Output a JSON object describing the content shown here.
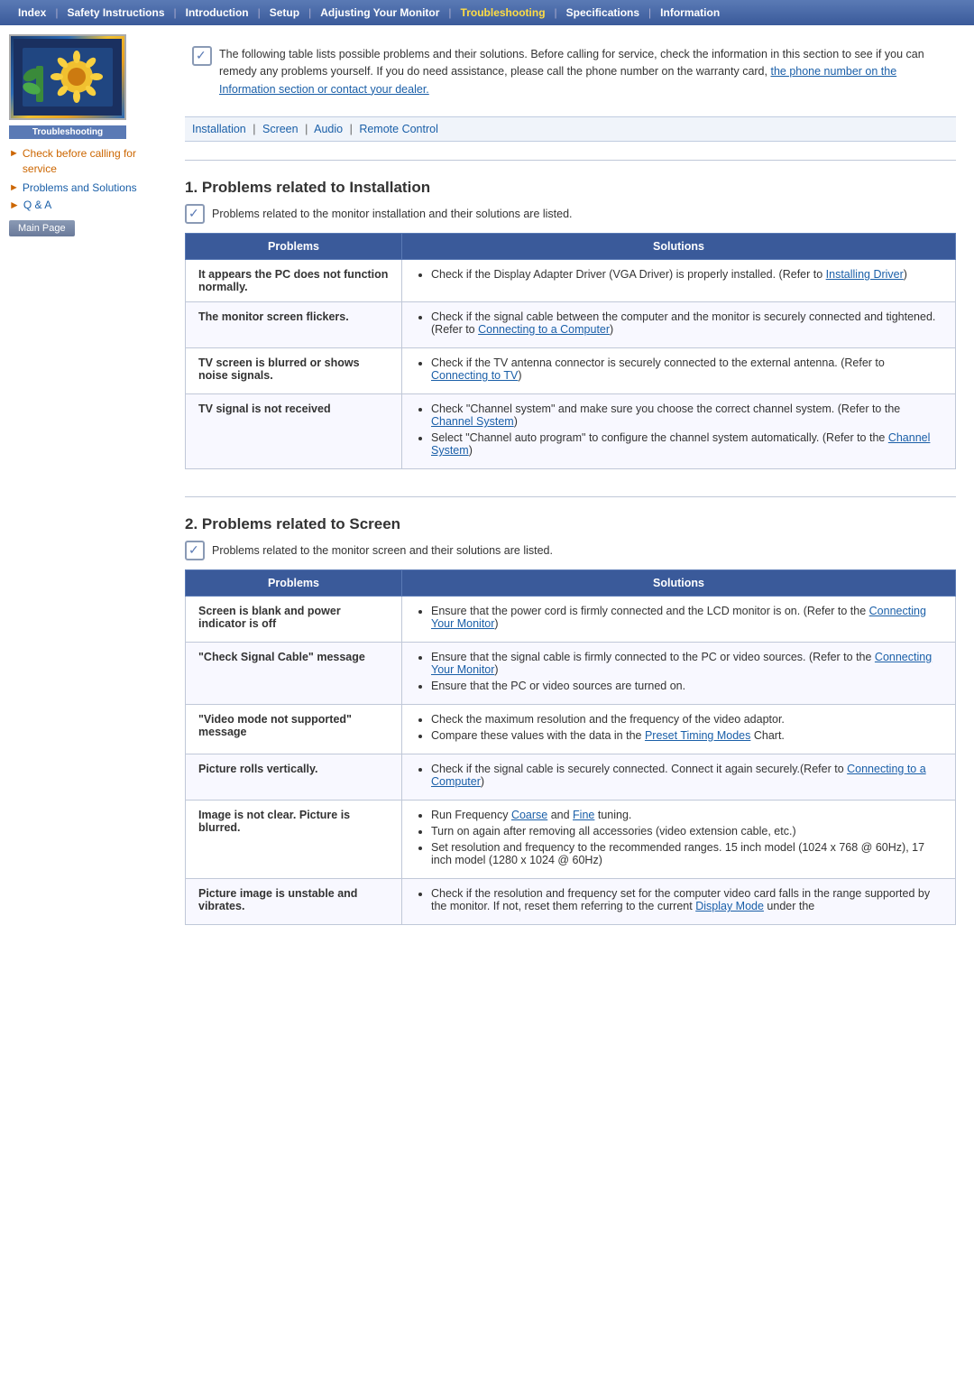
{
  "nav": {
    "items": [
      {
        "label": "Index",
        "active": false
      },
      {
        "label": "Safety Instructions",
        "active": false
      },
      {
        "label": "Introduction",
        "active": false
      },
      {
        "label": "Setup",
        "active": false
      },
      {
        "label": "Adjusting Your Monitor",
        "active": false
      },
      {
        "label": "Troubleshooting",
        "active": true
      },
      {
        "label": "Specifications",
        "active": false
      },
      {
        "label": "Information",
        "active": false
      }
    ]
  },
  "sidebar": {
    "image_label": "Troubleshooting",
    "links": [
      {
        "label": "Check before calling for service",
        "active": true
      },
      {
        "label": "Problems and Solutions",
        "active": false
      }
    ],
    "qa_label": "Q & A",
    "main_page_label": "Main Page"
  },
  "intro": {
    "text": "The following table lists possible problems and their solutions. Before calling for service, check the information in this section to see if you can remedy any problems yourself. If you do need assistance, please call the phone number on the warranty card,",
    "link_text": "the phone number on the Information section or contact your dealer.",
    "link_href": "#"
  },
  "sub_nav": {
    "items": [
      "Installation",
      "Screen",
      "Audio",
      "Remote Control"
    ]
  },
  "section1": {
    "number": "1.",
    "title": "Problems related to Installation",
    "subtitle": "Problems related to the monitor installation and their solutions are listed.",
    "col_problems": "Problems",
    "col_solutions": "Solutions",
    "rows": [
      {
        "problem": "It appears the PC does not function normally.",
        "solutions": [
          "Check if the Display Adapter Driver (VGA Driver) is properly installed. (Refer to Installing Driver)"
        ]
      },
      {
        "problem": "The monitor screen flickers.",
        "solutions": [
          "Check if the signal cable between the computer and the monitor is securely connected and tightened. (Refer to Connecting to a Computer)"
        ]
      },
      {
        "problem": "TV screen is blurred or shows noise signals.",
        "solutions": [
          "Check if the TV antenna connector is securely connected to the external antenna. (Refer to Connecting to TV)"
        ]
      },
      {
        "problem": "TV signal is not received",
        "solutions": [
          "Check \"Channel system\" and make sure you choose the correct channel system. (Refer to the Channel System)",
          "Select \"Channel auto program\" to configure the channel system automatically. (Refer to the Channel System)"
        ]
      }
    ]
  },
  "section2": {
    "number": "2.",
    "title": "Problems related to Screen",
    "subtitle": "Problems related to the monitor screen and their solutions are listed.",
    "col_problems": "Problems",
    "col_solutions": "Solutions",
    "rows": [
      {
        "problem": "Screen is blank and power indicator is off",
        "solutions": [
          "Ensure that the power cord is firmly connected and the LCD monitor is on. (Refer to the Connecting Your Monitor)"
        ]
      },
      {
        "problem": "\"Check Signal Cable\" message",
        "solutions": [
          "Ensure that the signal cable is firmly connected to the PC or video sources. (Refer to the Connecting Your Monitor)",
          "Ensure that the PC or video sources are turned on."
        ]
      },
      {
        "problem": "\"Video mode not supported\" message",
        "solutions": [
          "Check the maximum resolution and the frequency of the video adaptor.",
          "Compare these values with the data in the Preset Timing Modes Chart."
        ]
      },
      {
        "problem": "Picture rolls vertically.",
        "solutions": [
          "Check if the signal cable is securely connected. Connect it again securely.(Refer to Connecting to a Computer)"
        ]
      },
      {
        "problem": "Image is not clear. Picture is blurred.",
        "solutions": [
          "Run Frequency Coarse and Fine tuning.",
          "Turn on again after removing all accessories (video extension cable, etc.)",
          "Set resolution and frequency to the recommended ranges. 15 inch model (1024 x 768 @ 60Hz), 17 inch model (1280 x 1024 @ 60Hz)"
        ]
      },
      {
        "problem": "Picture image is unstable and vibrates.",
        "solutions": [
          "Check if the resolution and frequency set for the computer video card falls in the range supported by the monitor. If not, reset them referring to the current Display Mode under the"
        ]
      }
    ]
  }
}
